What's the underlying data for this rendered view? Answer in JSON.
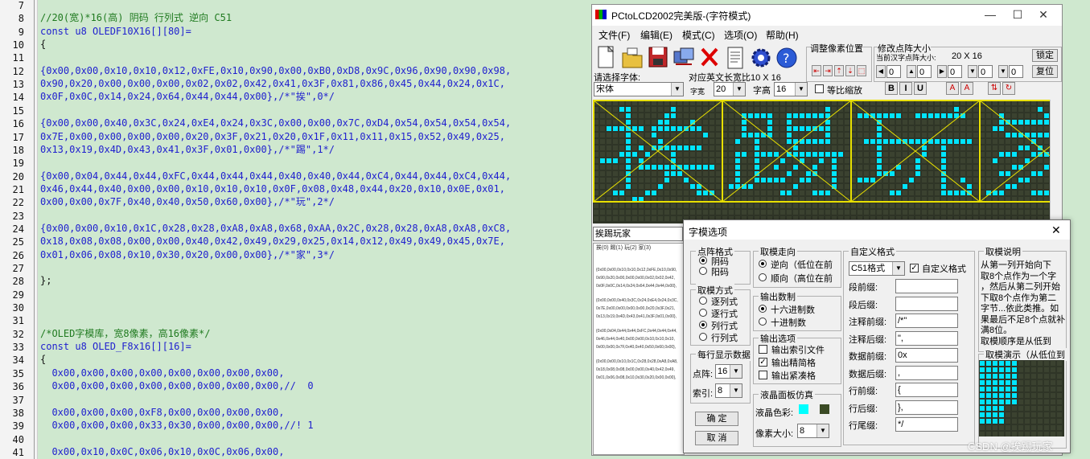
{
  "editor": {
    "lines": [
      {
        "n": "7",
        "text": ""
      },
      {
        "n": "8",
        "text": "//20(宽)*16(高) 阴码 行列式 逆向 C51",
        "cls": "cm"
      },
      {
        "n": "9",
        "text": "const u8 OLEDF10X16[][80]=",
        "cls": "kw"
      },
      {
        "n": "10",
        "text": "{",
        "cls": "blk"
      },
      {
        "n": "11",
        "text": ""
      },
      {
        "n": "12",
        "text": "{0x00,0x00,0x10,0x10,0x12,0xFE,0x10,0x90,0x00,0xB0,0xD8,0x9C,0x96,0x90,0x90,0x98,"
      },
      {
        "n": "13",
        "text": "0x90,0x20,0x00,0x00,0x00,0x02,0x02,0x42,0x41,0x3F,0x81,0x86,0x45,0x44,0x24,0x1C,"
      },
      {
        "n": "14",
        "text": "0x0F,0x0C,0x14,0x24,0x64,0x44,0x44,0x00},/*\"挨\",0*/"
      },
      {
        "n": "15",
        "text": ""
      },
      {
        "n": "16",
        "text": "{0x00,0x00,0x40,0x3C,0x24,0xE4,0x24,0x3C,0x00,0x00,0x7C,0xD4,0x54,0x54,0x54,0x54,"
      },
      {
        "n": "17",
        "text": "0x7E,0x00,0x00,0x00,0x00,0x20,0x3F,0x21,0x20,0x1F,0x11,0x11,0x15,0x52,0x49,0x25,"
      },
      {
        "n": "18",
        "text": "0x13,0x19,0x4D,0x43,0x41,0x3F,0x01,0x00},/*\"踢\",1*/"
      },
      {
        "n": "19",
        "text": ""
      },
      {
        "n": "20",
        "text": "{0x00,0x04,0x44,0x44,0xFC,0x44,0x44,0x44,0x40,0x40,0x44,0xC4,0x44,0x44,0xC4,0x44,"
      },
      {
        "n": "21",
        "text": "0x46,0x44,0x40,0x00,0x00,0x10,0x10,0x10,0x0F,0x08,0x48,0x44,0x20,0x10,0x0E,0x01,"
      },
      {
        "n": "22",
        "text": "0x00,0x00,0x7F,0x40,0x40,0x50,0x60,0x00},/*\"玩\",2*/"
      },
      {
        "n": "23",
        "text": ""
      },
      {
        "n": "24",
        "text": "{0x00,0x00,0x10,0x1C,0x28,0x28,0xA8,0xA8,0x68,0xAA,0x2C,0x28,0x28,0xA8,0xA8,0xC8,"
      },
      {
        "n": "25",
        "text": "0x18,0x08,0x08,0x00,0x00,0x40,0x42,0x49,0x29,0x25,0x14,0x12,0x49,0x49,0x45,0x7E,"
      },
      {
        "n": "26",
        "text": "0x01,0x06,0x08,0x10,0x30,0x20,0x00,0x00},/*\"家\",3*/"
      },
      {
        "n": "27",
        "text": ""
      },
      {
        "n": "28",
        "text": "};",
        "cls": "blk"
      },
      {
        "n": "29",
        "text": ""
      },
      {
        "n": "30",
        "text": ""
      },
      {
        "n": "31",
        "text": ""
      },
      {
        "n": "32",
        "text": "/*OLED字模库，宽8像素，高16像素*/",
        "cls": "cm"
      },
      {
        "n": "33",
        "text": "const u8 OLED_F8x16[][16]=",
        "cls": "kw"
      },
      {
        "n": "34",
        "text": "{",
        "cls": "blk"
      },
      {
        "n": "35",
        "text": "  0x00,0x00,0x00,0x00,0x00,0x00,0x00,0x00,"
      },
      {
        "n": "36",
        "text": "  0x00,0x00,0x00,0x00,0x00,0x00,0x00,0x00,//  0"
      },
      {
        "n": "37",
        "text": ""
      },
      {
        "n": "38",
        "text": "  0x00,0x00,0x00,0xF8,0x00,0x00,0x00,0x00,"
      },
      {
        "n": "39",
        "text": "  0x00,0x00,0x00,0x33,0x30,0x00,0x00,0x00,//! 1"
      },
      {
        "n": "40",
        "text": ""
      },
      {
        "n": "41",
        "text": "  0x00,0x10,0x0C,0x06,0x10,0x0C,0x06,0x00,"
      }
    ]
  },
  "app": {
    "title": "PCtoLCD2002完美版-(字符模式)",
    "controls": {
      "minimize": "—",
      "maximize": "☐",
      "close": "✕"
    },
    "menus": [
      "文件(F)",
      "编辑(E)",
      "模式(C)",
      "选项(O)",
      "帮助(H)"
    ],
    "toolbar_icons": [
      "new-file-icon",
      "open-folder-icon",
      "save-disk-icon",
      "export-icon",
      "delete-x-icon",
      "notes-icon",
      "settings-gear-icon",
      "help-question-icon"
    ],
    "adjust_group_label": "调整像素位置",
    "modify_group_label": "修改点阵大小",
    "current_size_label": "当前汉字点阵大小:",
    "current_size_value": "20  X  16",
    "lock_button": "锁定",
    "restore_button": "复位",
    "spin_values": [
      "0",
      "0",
      "0",
      "0",
      "0"
    ],
    "font_label": "请选择字体:",
    "font_value": "宋体",
    "ratio_label": "对应英文长宽比10 X 16",
    "width_label": "字宽",
    "width_value": "20",
    "height_label": "字高",
    "height_value": "16",
    "equal_scale_label": "等比缩放",
    "style_buttons": [
      "B",
      "I",
      "U"
    ],
    "text_input": "挨踢玩家",
    "preview_header": "挨(0) 踢(1) 玩(2) 家(3)",
    "preview_lines": [
      "{0x00,0x00,0x10,0x10,0x12,0xFE,0x10,0x90,",
      "0x90,0x20,0x00,0x00,0x00,0x02,0x02,0x42,",
      "0x0F,0x0C,0x14,0x24,0x64,0x44,0x44,0x00},",
      "{0x00,0x00,0x40,0x3C,0x24,0xE4,0x24,0x3C,",
      "0x7E,0x00,0x00,0x00,0x00,0x20,0x3F,0x21,",
      "0x13,0x19,0x4D,0x43,0x41,0x3F,0x01,0x00},",
      "{0x00,0x04,0x44,0x44,0xFC,0x44,0x44,0x44,",
      "0x46,0x44,0x40,0x00,0x00,0x10,0x10,0x10,",
      "0x00,0x00,0x7F,0x40,0x40,0x50,0x60,0x00},",
      "{0x00,0x00,0x10,0x1C,0x28,0x28,0xA8,0xA8,",
      "0x18,0x08,0x08,0x00,0x00,0x40,0x42,0x49,",
      "0x01,0x06,0x08,0x10,0x30,0x20,0x00,0x00},"
    ],
    "lcd_colors": {
      "background": "#2f3527",
      "pixel_on": "#00e5ff",
      "grid": "#1c2018",
      "frame": "#e8e000"
    }
  },
  "dialog": {
    "title": "字模选项",
    "close": "✕",
    "format_group": "点阵格式",
    "format_options": [
      {
        "label": "阴码",
        "on": true
      },
      {
        "label": "阳码",
        "on": false
      }
    ],
    "mode_group": "取模方式",
    "mode_options": [
      {
        "label": "逐列式",
        "on": false
      },
      {
        "label": "逐行式",
        "on": false
      },
      {
        "label": "列行式",
        "on": true
      },
      {
        "label": "行列式",
        "on": false
      }
    ],
    "rows_group": "每行显示数据",
    "dots_label": "点阵:",
    "dots_value": "16",
    "index_label": "索引:",
    "index_value": "8",
    "ok_button": "确    定",
    "cancel_button": "取    消",
    "direction_group": "取模走向",
    "direction_options": [
      {
        "label": "逆向（低位在前",
        "on": true
      },
      {
        "label": "顺向（高位在前",
        "on": false
      }
    ],
    "number_group": "输出数制",
    "number_options": [
      {
        "label": "十六进制数",
        "on": true
      },
      {
        "label": "十进制数",
        "on": false
      }
    ],
    "output_group": "输出选项",
    "output_options": [
      {
        "label": "输出索引文件",
        "on": false
      },
      {
        "label": "输出精简格",
        "on": true
      },
      {
        "label": "输出紧凑格",
        "on": false
      }
    ],
    "lcd_group": "液晶面板仿真",
    "lcd_color_label": "液晶色彩:",
    "pixel_size_label": "像素大小:",
    "pixel_size_value": "8",
    "custom_group": "自定义格式",
    "custom_format_value": "C51格式",
    "custom_check_label": "自定义格式",
    "fields": [
      {
        "label": "段前缀:",
        "value": ""
      },
      {
        "label": "段后缀:",
        "value": ""
      },
      {
        "label": "注释前缀:",
        "value": "/*\""
      },
      {
        "label": "注释后缀:",
        "value": "\","
      },
      {
        "label": "数据前缀:",
        "value": "0x"
      },
      {
        "label": "数据后缀:",
        "value": ","
      },
      {
        "label": "行前缀:",
        "value": "{"
      },
      {
        "label": "行后缀:",
        "value": "},"
      },
      {
        "label": "行尾缀:",
        "value": "*/"
      }
    ],
    "explain_group": "取模说明",
    "explain_lines": [
      "从第一列开始向下",
      "取8个点作为一个字",
      "，然后从第二列开始",
      "下取8个点作为第二",
      "字节...依此类推。如",
      "果最后不足8个点就补",
      "满8位。",
      "取模顺序是从低到"
    ],
    "demo_group": "取模演示（从低位到",
    "lcd_color_swatches": [
      "#00ffff",
      "#3a4a24"
    ]
  },
  "watermark": "CSDN @挨踢玩家"
}
